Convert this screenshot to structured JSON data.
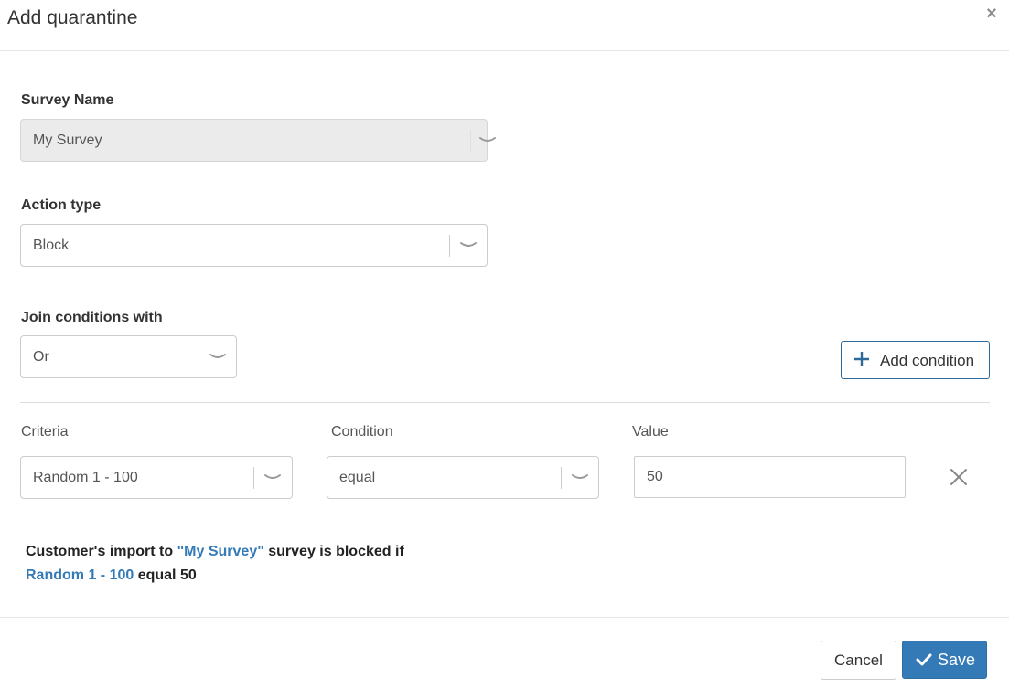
{
  "dialog": {
    "title": "Add quarantine",
    "close_icon": "close-icon"
  },
  "survey_name": {
    "label": "Survey Name",
    "value": "My Survey",
    "disabled": true
  },
  "action_type": {
    "label": "Action type",
    "value": "Block"
  },
  "join_conditions": {
    "label": "Join conditions with",
    "value": "Or"
  },
  "add_condition": {
    "label": "Add condition",
    "icon": "plus-icon"
  },
  "conditions": {
    "headers": {
      "criteria": "Criteria",
      "condition": "Condition",
      "value": "Value"
    },
    "rows": [
      {
        "criteria": "Random 1 - 100",
        "condition": "equal",
        "value": "50",
        "remove_icon": "remove-icon"
      }
    ]
  },
  "summary": {
    "line1_prefix": "Customer's import to ",
    "line1_survey": "\"My Survey\"",
    "line1_suffix": " survey is blocked if",
    "line2_criteria": "Random 1 - 100",
    "line2_rest": " equal 50"
  },
  "footer": {
    "cancel_label": "Cancel",
    "save_label": "Save",
    "save_icon": "check-icon"
  },
  "colors": {
    "primary": "#337ab7",
    "highlight_text": "#337ab7",
    "disabled_bg": "#ebebeb"
  }
}
